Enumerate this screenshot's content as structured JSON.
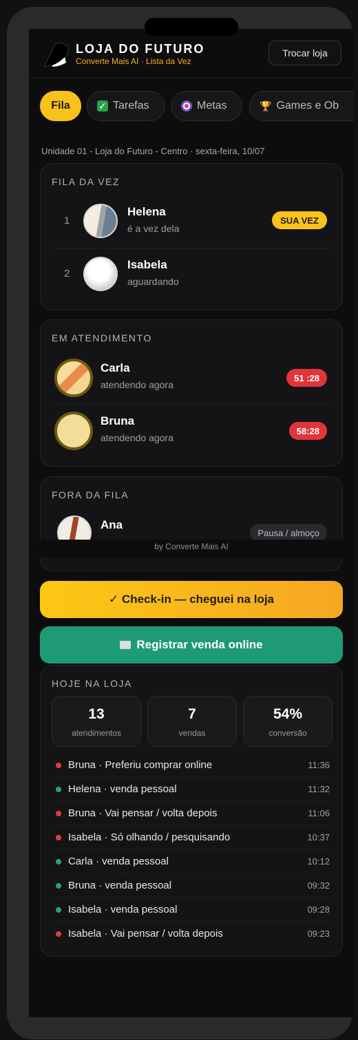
{
  "brand": {
    "title": "LOJA DO FUTURO",
    "subtitle": "Converte Mais AI · Lista da Vez",
    "switch_label": "Trocar loja"
  },
  "tabs": [
    {
      "label": "Fila",
      "icon": "",
      "active": true
    },
    {
      "label": "Tarefas",
      "icon": "checkmark-icon"
    },
    {
      "label": "Metas",
      "icon": "target-icon"
    },
    {
      "label": "Games e Ob",
      "icon": "trophy-icon"
    }
  ],
  "unit_line": "Unidade 01 - Loja do Futuro - Centro · sexta-feira, 10/07",
  "queue": {
    "title": "FILA DA VEZ",
    "rows": [
      {
        "pos": "1",
        "name": "Helena",
        "status": "é a vez dela",
        "badge": "SUA VEZ"
      },
      {
        "pos": "2",
        "name": "Isabela",
        "status": "aguardando",
        "badge": ""
      }
    ]
  },
  "serving": {
    "title": "EM ATENDIMENTO",
    "rows": [
      {
        "name": "Carla",
        "status": "atendendo agora",
        "timer": "51 :28"
      },
      {
        "name": "Bruna",
        "status": "atendendo agora",
        "timer": "58:28"
      }
    ]
  },
  "out": {
    "title": "FORA DA FILA",
    "rows": [
      {
        "name": "Ana",
        "status": "Pausa / almoço"
      }
    ]
  },
  "footer": "by Converte Mais AI",
  "actions": {
    "checkin": "✓ Check-in — cheguei na loja",
    "sale": "Registrar venda online"
  },
  "today": {
    "title": "HOJE NA LOJA",
    "stats": [
      {
        "value": "13",
        "label": "atendimentos"
      },
      {
        "value": "7",
        "label": "vendas"
      },
      {
        "value": "54%",
        "label": "conversão"
      }
    ],
    "log": [
      {
        "text": "Bruna · Preferiu comprar online",
        "time": "11:36",
        "color": "#e5393f"
      },
      {
        "text": "Helena · venda pessoal",
        "time": "11:32",
        "color": "#22a57d"
      },
      {
        "text": "Bruna · Vai pensar / volta depois",
        "time": "11:06",
        "color": "#e5393f"
      },
      {
        "text": "Isabela · Só olhando / pesquisando",
        "time": "10:37",
        "color": "#e5393f"
      },
      {
        "text": "Carla · venda pessoal",
        "time": "10:12",
        "color": "#22a57d"
      },
      {
        "text": "Bruna · venda pessoal",
        "time": "09:32",
        "color": "#22a57d"
      },
      {
        "text": "Isabela · venda pessoal",
        "time": "09:28",
        "color": "#22a57d"
      },
      {
        "text": "Isabela · Vai pensar / volta depois",
        "time": "09:23",
        "color": "#e5393f"
      }
    ]
  }
}
